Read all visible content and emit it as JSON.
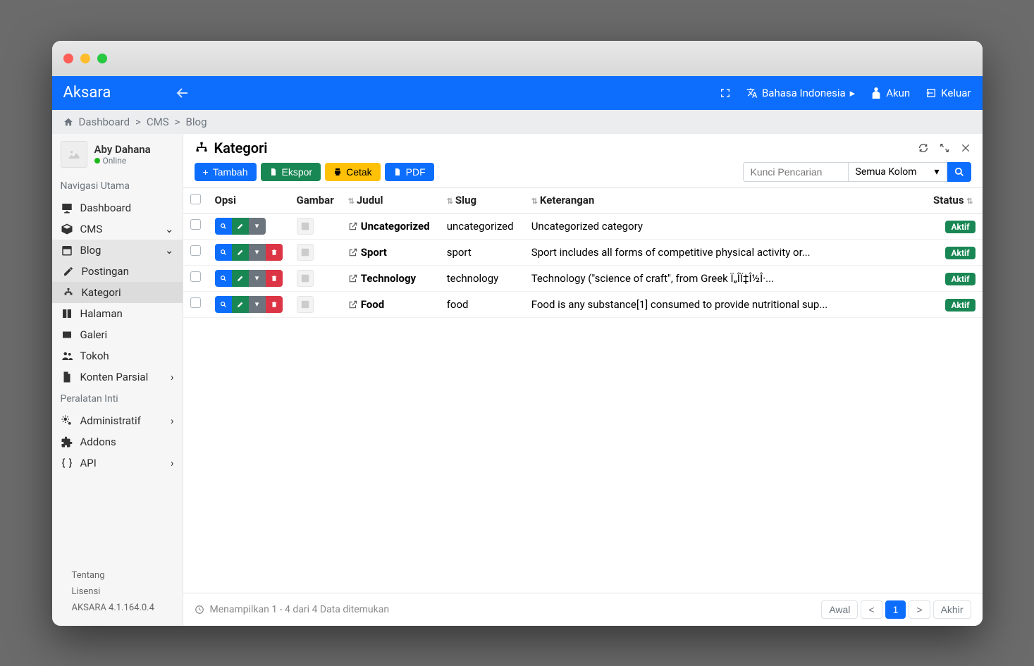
{
  "brand": "Aksara",
  "nav_top": {
    "language": "Bahasa Indonesia",
    "account": "Akun",
    "logout": "Keluar"
  },
  "breadcrumb": [
    "Dashboard",
    "CMS",
    "Blog"
  ],
  "user": {
    "name": "Aby Dahana",
    "status": "Online"
  },
  "sidebar": {
    "section_main": "Navigasi Utama",
    "dashboard": "Dashboard",
    "cms": "CMS",
    "blog": "Blog",
    "postingan": "Postingan",
    "kategori": "Kategori",
    "halaman": "Halaman",
    "galeri": "Galeri",
    "tokoh": "Tokoh",
    "konten_parsial": "Konten Parsial",
    "section_tools": "Peralatan Inti",
    "administratif": "Administratif",
    "addons": "Addons",
    "api": "API",
    "footer_tentang": "Tentang",
    "footer_lisensi": "Lisensi",
    "footer_version": "AKSARA 4.1.164.0.4"
  },
  "page": {
    "title": "Kategori",
    "toolbar": {
      "tambah": "Tambah",
      "ekspor": "Ekspor",
      "cetak": "Cetak",
      "pdf": "PDF"
    },
    "search_placeholder": "Kunci Pencarian",
    "column_select": "Semua Kolom"
  },
  "table": {
    "headers": {
      "opsi": "Opsi",
      "gambar": "Gambar",
      "judul": "Judul",
      "slug": "Slug",
      "keterangan": "Keterangan",
      "status": "Status"
    },
    "rows": [
      {
        "judul": "Uncategorized",
        "slug": "uncategorized",
        "ket": "Uncategorized category",
        "status": "Aktif",
        "deletable": false
      },
      {
        "judul": "Sport",
        "slug": "sport",
        "ket": "Sport includes all forms of competitive physical activity or...",
        "status": "Aktif",
        "deletable": true
      },
      {
        "judul": "Technology",
        "slug": "technology",
        "ket": "Technology (\"science of craft\", from Greek Ï„Î­Ï‡Î½Î·...",
        "status": "Aktif",
        "deletable": true
      },
      {
        "judul": "Food",
        "slug": "food",
        "ket": "Food is any substance[1] consumed to provide nutritional sup...",
        "status": "Aktif",
        "deletable": true
      }
    ]
  },
  "footer": {
    "info": "Menampilkan 1 - 4 dari 4 Data ditemukan",
    "first": "Awal",
    "prev": "<",
    "page": "1",
    "next": ">",
    "last": "Akhir"
  }
}
